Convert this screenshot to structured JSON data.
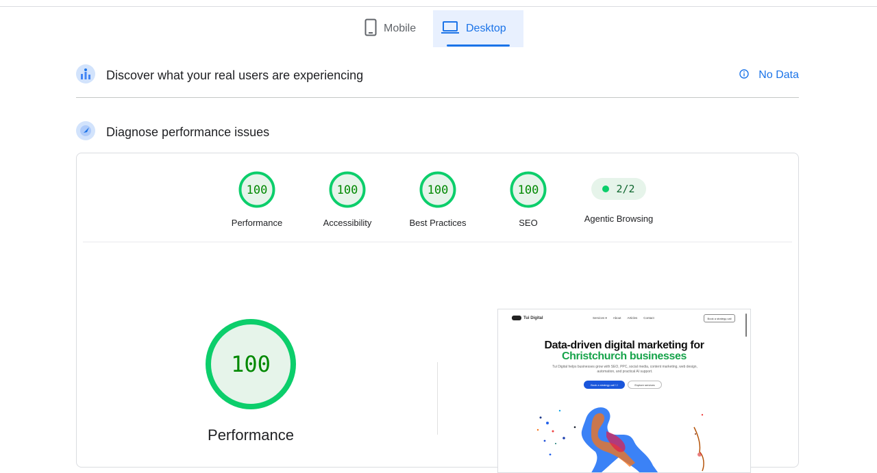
{
  "tabs": [
    {
      "label": "Mobile",
      "icon": "smartphone-icon",
      "selected": false
    },
    {
      "label": "Desktop",
      "icon": "laptop-icon",
      "selected": true
    }
  ],
  "crux": {
    "title": "Discover what your real users are experiencing",
    "status": "No Data",
    "status_icon": "info-icon"
  },
  "diagnose": {
    "title": "Diagnose performance issues"
  },
  "gauges": [
    {
      "name": "Performance",
      "score": "100"
    },
    {
      "name": "Accessibility",
      "score": "100"
    },
    {
      "name": "Best Practices",
      "score": "100"
    },
    {
      "name": "SEO",
      "score": "100"
    }
  ],
  "agentic": {
    "name": "Agentic Browsing",
    "value": "2/2"
  },
  "main_gauge": {
    "name": "Performance",
    "score": "100"
  },
  "thumbnail": {
    "logo": "Tui Digital",
    "nav_links": [
      "Services ▾",
      "About",
      "Articles",
      "Contact"
    ],
    "cta_top": "Book a strategy call",
    "headline_1": "Data-driven digital marketing for",
    "headline_2": "Christchurch businesses",
    "subtext": "Tui Digital helps businesses grow with SEO, PPC, social media, content marketing, web design, automation, and practical AI support.",
    "button_primary": "Book a strategy call ☐",
    "button_secondary": "Explore services"
  },
  "colors": {
    "pass": "#0cce6b",
    "pass_fill": "#e6f4ea",
    "pass_text": "#008800",
    "accent": "#1a73e8"
  }
}
